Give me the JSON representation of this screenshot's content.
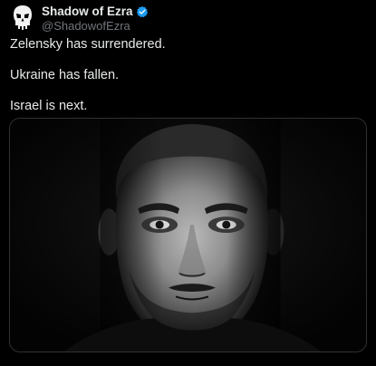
{
  "author": {
    "display_name": "Shadow of Ezra",
    "handle": "@ShadowofEzra",
    "verified": true,
    "avatar_icon": "punisher-skull-icon",
    "verified_icon": "verified-badge-icon"
  },
  "tweet": {
    "lines": [
      "Zelensky has surrendered.",
      "Ukraine has fallen.",
      "Israel is next."
    ]
  },
  "media": {
    "type": "photo",
    "style": "black-and-white portrait"
  },
  "colors": {
    "background": "#000000",
    "primary_text": "#e7e9ea",
    "secondary_text": "#71767b",
    "verified_blue": "#1d9bf0",
    "border": "#2f3336"
  }
}
